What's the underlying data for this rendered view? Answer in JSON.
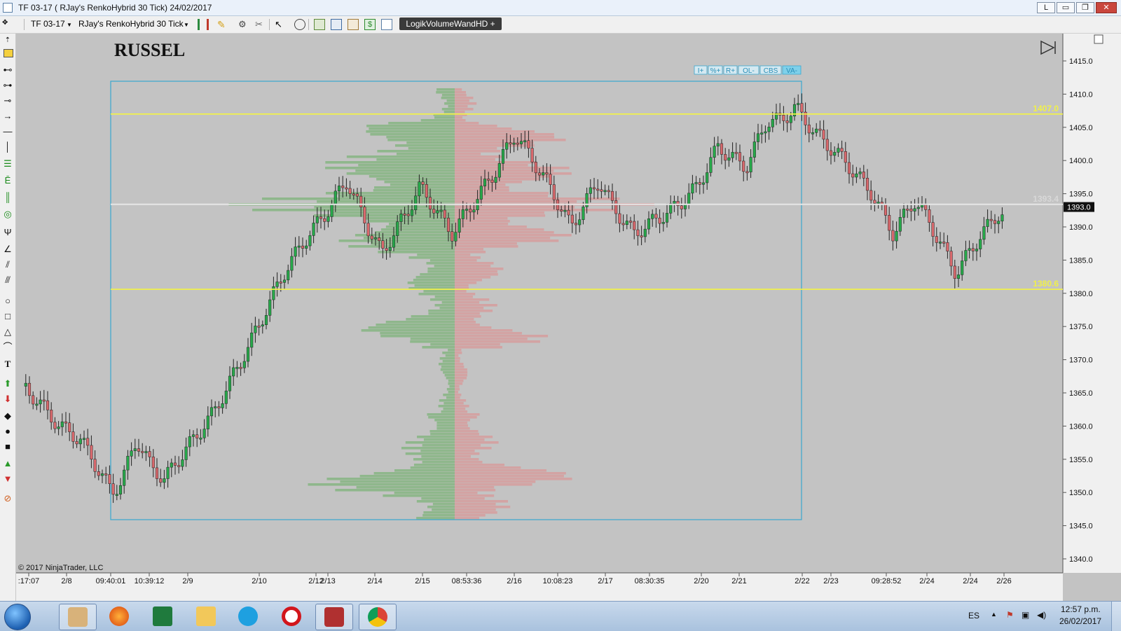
{
  "window": {
    "title": "TF 03-17 ( RJay's RenkoHybrid  30 Tick)  24/02/2017",
    "controls": [
      "L",
      "▭",
      "❐",
      "✕"
    ]
  },
  "toolbar": {
    "instrument": "TF 03-17",
    "bar_type": "RJay's RenkoHybrid  30 Tick",
    "indicator_button": "LogikVolumeWandHD +"
  },
  "chart": {
    "watermark": "RUSSEL",
    "copyright": "© 2017 NinjaTrader, LLC",
    "profile_buttons": [
      "I+",
      "%+",
      "R+",
      "OL-",
      "CBS",
      "VA-"
    ],
    "levels": {
      "upper": {
        "label": "1407.0",
        "color": "#f5f542"
      },
      "mid": {
        "label": "1393.4",
        "color": "#dcdcdc"
      },
      "lower": {
        "label": "1380.6",
        "color": "#f5f542"
      },
      "current": {
        "label": "1393.0"
      }
    },
    "price_ticks": [
      "1415.0",
      "1410.0",
      "1405.0",
      "1400.0",
      "1395.0",
      "1390.0",
      "1385.0",
      "1380.0",
      "1375.0",
      "1370.0",
      "1365.0",
      "1360.0",
      "1355.0",
      "1350.0",
      "1345.0",
      "1340.0"
    ],
    "time_ticks": [
      ":17:07",
      "2/8",
      "09:40:01",
      "10:39:12",
      "2/9",
      "2/10",
      "2/12",
      "2/13",
      "2/14",
      "2/15",
      "08:53:36",
      "2/16",
      "10:08:23",
      "2/17",
      "08:30:35",
      "2/20",
      "2/21",
      "2/22",
      "2/23",
      "09:28:52",
      "2/24",
      "2/24",
      "2/26"
    ],
    "colors": {
      "bg": "#c3c3c3",
      "up": "#27a94a",
      "down": "#d9696d",
      "box": "#3aa7cf",
      "profile_buy": "#8fb78c",
      "profile_sell": "#d3a3a3"
    }
  },
  "taskbar": {
    "lang": "ES",
    "time": "12:57 p.m.",
    "date": "26/02/2017"
  }
}
